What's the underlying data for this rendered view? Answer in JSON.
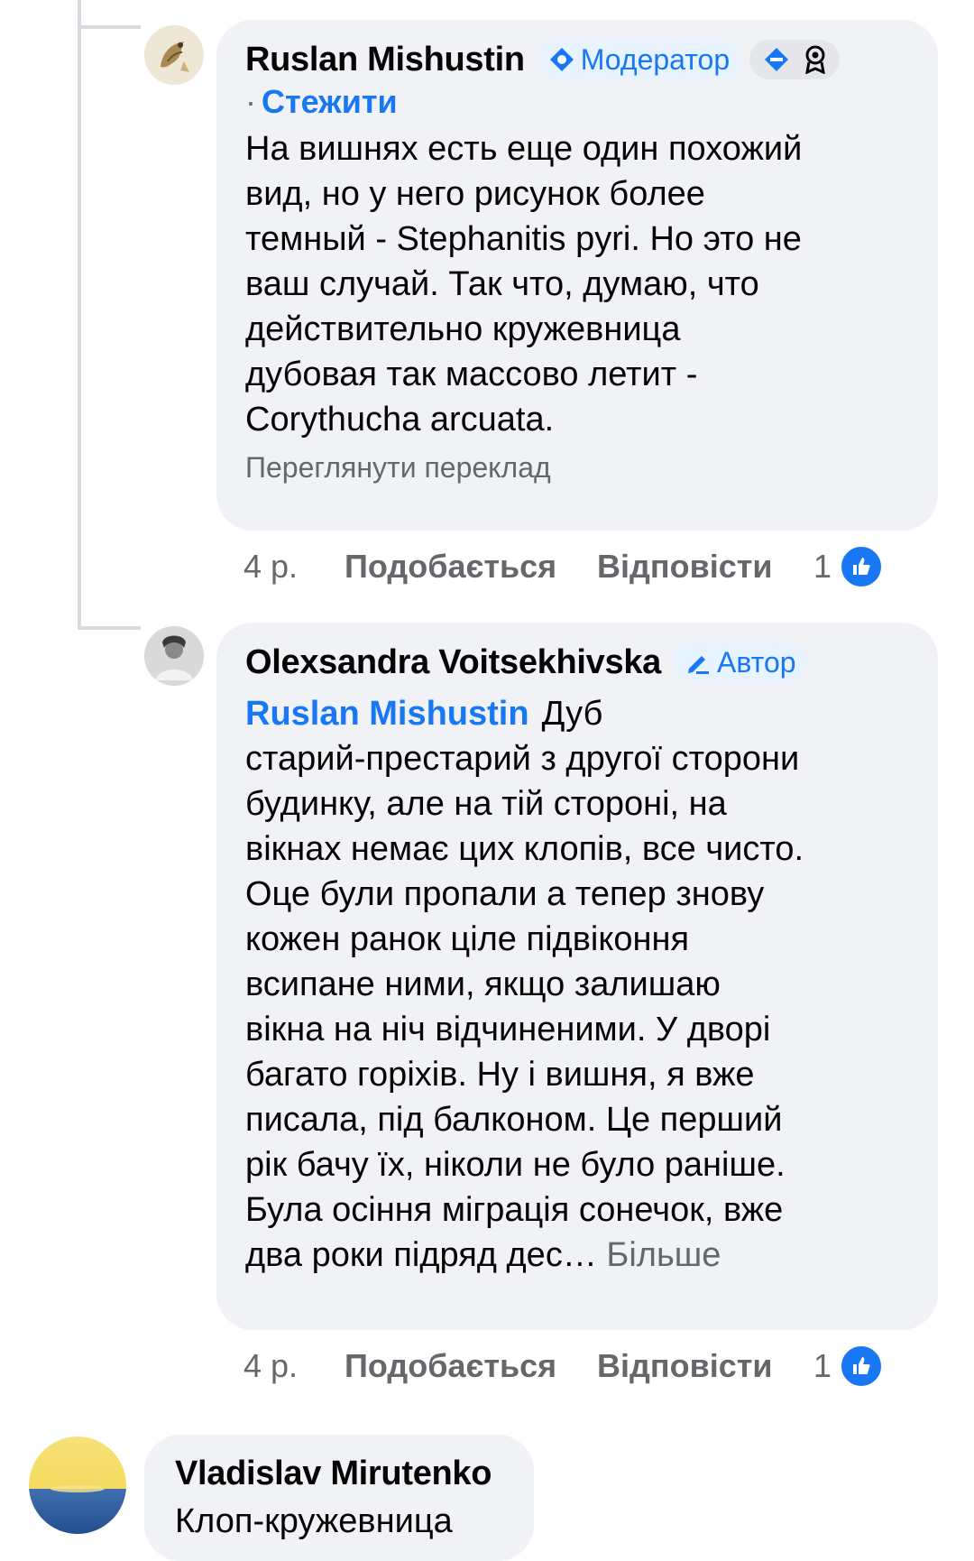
{
  "comments": [
    {
      "author": "Ruslan Mishustin",
      "badge": "Модератор",
      "follow": "Стежити",
      "lines": [
        "На вишнях есть еще один похожий",
        "вид, но у него рисунок более",
        "темный - Stephanitis pyri. Но это не",
        "ваш случай. Так что, думаю, что",
        "действительно кружевница",
        "дубовая так массово летит -",
        "Corythucha arcuata."
      ],
      "translate": "Переглянути переклад",
      "time": "4 р.",
      "like": "Подобається",
      "reply": "Відповісти",
      "likes": "1"
    },
    {
      "author": "Olexsandra Voitsekhivska",
      "badge": "Автор",
      "mention": "Ruslan Mishustin",
      "first_line": "Дуб",
      "lines": [
        "старий-престарий з другої сторони",
        "будинку, але на тій стороні, на",
        "вікнах немає цих клопів, все чисто.",
        "Оце були пропали а тепер знову",
        "кожен ранок ціле підвіконня",
        "всипане ними, якщо залишаю",
        "вікна на ніч відчиненими. У дворі",
        "багато горіхів. Ну і вишня, я вже",
        "писала, під балконом. Це перший",
        "рік бачу їх, ніколи не було раніше.",
        "Була осіння міграція сонечок, вже"
      ],
      "last_line": "два роки підряд дес…",
      "more": "Більше",
      "time": "4 р.",
      "like": "Подобається",
      "reply": "Відповісти",
      "likes": "1"
    },
    {
      "author": "Vladislav Mirutenko",
      "text": "Клоп-кружевница"
    }
  ],
  "colors": {
    "link": "#1877f2",
    "bubble": "#f0f2f5",
    "secondary_text": "#65676b",
    "thread_line": "#d8dadf"
  }
}
